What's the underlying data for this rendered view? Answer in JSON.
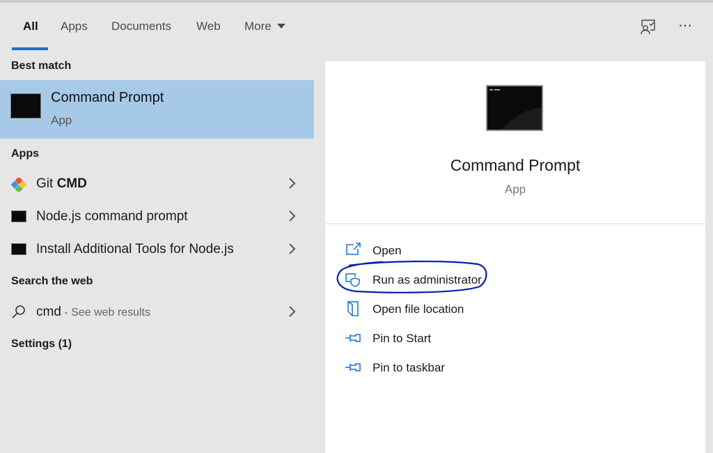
{
  "tabs": [
    {
      "label": "All"
    },
    {
      "label": "Apps"
    },
    {
      "label": "Documents"
    },
    {
      "label": "Web"
    },
    {
      "label": "More"
    }
  ],
  "toolbar": {
    "feedback_icon": "feedback-icon",
    "more_options": "⋯"
  },
  "left": {
    "best_match_title": "Best match",
    "best_match": {
      "name": "Command Prompt",
      "type": "App"
    },
    "apps_title": "Apps",
    "apps": [
      {
        "prefix": "Git ",
        "bold": "CMD",
        "icon": "git-icon"
      },
      {
        "prefix": "Node.js command prompt",
        "bold": "",
        "icon": "console-icon"
      },
      {
        "prefix": "Install Additional Tools for Node.js",
        "bold": "",
        "icon": "console-icon"
      }
    ],
    "web_title": "Search the web",
    "web": {
      "query": "cmd",
      "hint": " - See web results"
    },
    "settings_title": "Settings (1)"
  },
  "right": {
    "name": "Command Prompt",
    "type": "App",
    "actions": [
      {
        "label": "Open"
      },
      {
        "label": "Run as administrator"
      },
      {
        "label": "Open file location"
      },
      {
        "label": "Pin to Start"
      },
      {
        "label": "Pin to taskbar"
      }
    ]
  },
  "colors": {
    "accent": "#1a6ec7",
    "selected": "#a7c9e8",
    "annotation": "#0b1fa8"
  }
}
